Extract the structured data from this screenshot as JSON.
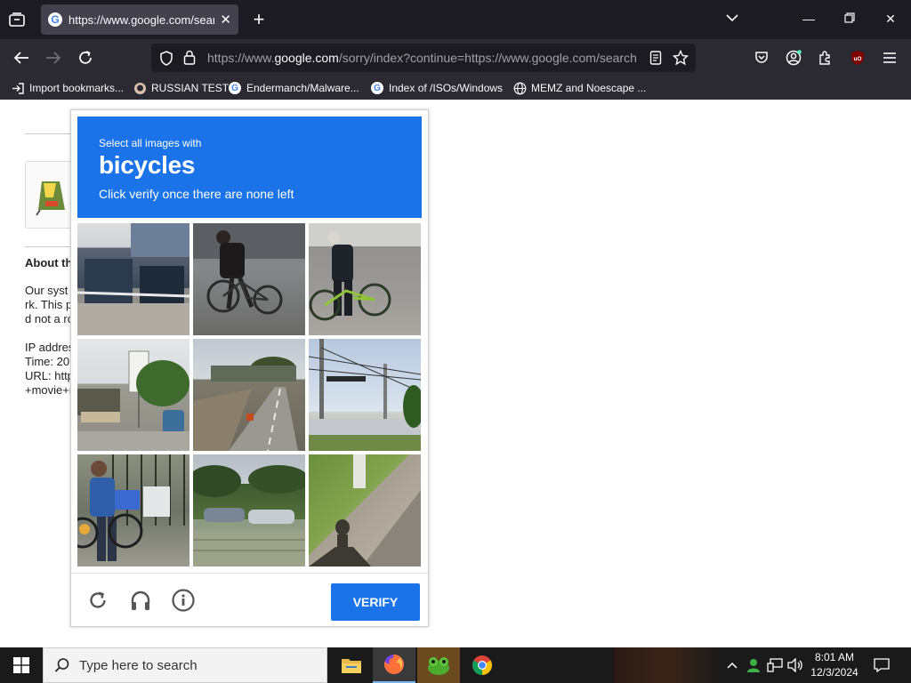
{
  "browser": {
    "tab": {
      "title": "https://www.google.com/search",
      "favicon": "google-icon"
    },
    "url": {
      "prefix": "https://www.",
      "domain": "google.com",
      "rest": "/sorry/index?continue=https://www.google.com/search"
    },
    "bookmarks": [
      {
        "label": "Import bookmarks...",
        "icon": "import-icon"
      },
      {
        "label": "RUSSIAN TEST",
        "icon": "github-icon"
      },
      {
        "label": "Endermanch/Malware...",
        "icon": "google-icon"
      },
      {
        "label": "Index of /ISOs/Windows",
        "icon": "google-icon"
      },
      {
        "label": "MEMZ and Noescape ...",
        "icon": "globe-icon"
      }
    ]
  },
  "page": {
    "about": "About th",
    "paragraph": [
      "Our syst",
      "rk. This p",
      "d not a ro"
    ],
    "details": [
      "IP addres",
      "Time: 20",
      "URL: http",
      "+movie+r"
    ]
  },
  "captcha": {
    "instruction": "Select all images with",
    "target": "bicycles",
    "subtext": "Click verify once there are none left",
    "verify_label": "VERIFY",
    "tiles": [
      {
        "index": 1,
        "content": "street-building"
      },
      {
        "index": 2,
        "content": "cyclist-riding"
      },
      {
        "index": 3,
        "content": "man-with-bicycle"
      },
      {
        "index": 4,
        "content": "roadside-market"
      },
      {
        "index": 5,
        "content": "highway"
      },
      {
        "index": 6,
        "content": "power-lines"
      },
      {
        "index": 7,
        "content": "person-with-bicycle"
      },
      {
        "index": 8,
        "content": "parked-cars"
      },
      {
        "index": 9,
        "content": "grass-shadow"
      }
    ]
  },
  "taskbar": {
    "search_placeholder": "Type here to search",
    "time": "8:01 AM",
    "date": "12/3/2024"
  },
  "colors": {
    "accent": "#1a73e8",
    "tabbar": "#1c1b22",
    "toolbar": "#2b2a33"
  }
}
